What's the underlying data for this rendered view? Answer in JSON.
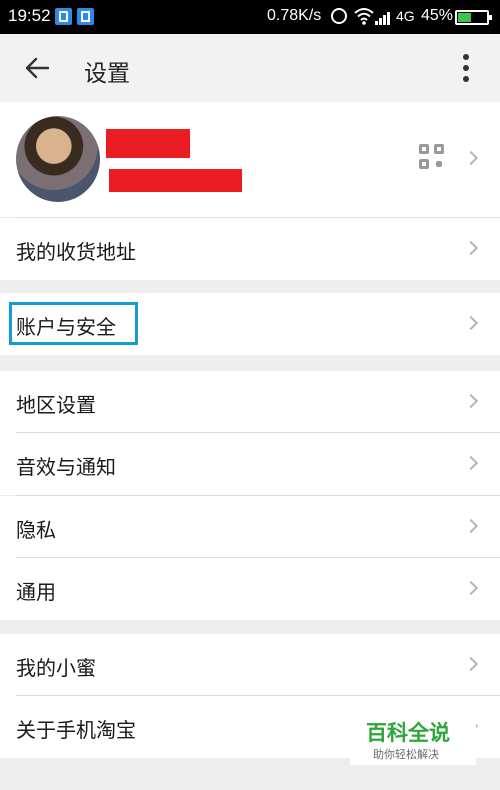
{
  "status_bar": {
    "time": "19:52",
    "speed": "0.78K/s",
    "network": "4G",
    "battery": "45%",
    "battery_level": 0.45,
    "icons": [
      "clipboard-icon",
      "scan-icon",
      "alarm-icon",
      "wifi-icon",
      "signal-icon",
      "battery-icon"
    ]
  },
  "toolbar": {
    "title": "设置",
    "back_icon": "arrow-left-icon",
    "more_icon": "more-vertical-icon"
  },
  "profile": {
    "avatar": "avatar",
    "qr_icon": "qr-code-icon"
  },
  "rows": {
    "address": "我的收货地址",
    "account": "账户与安全",
    "region": "地区设置",
    "sound": "音效与通知",
    "privacy": "隐私",
    "general": "通用",
    "xiaomi": "我的小蜜",
    "about": "关于手机淘宝"
  },
  "highlight_color": "#139bd8",
  "redaction_color": "#ec1c24",
  "watermark": {
    "title": "百科全说",
    "subtitle": "助你轻松解决"
  }
}
